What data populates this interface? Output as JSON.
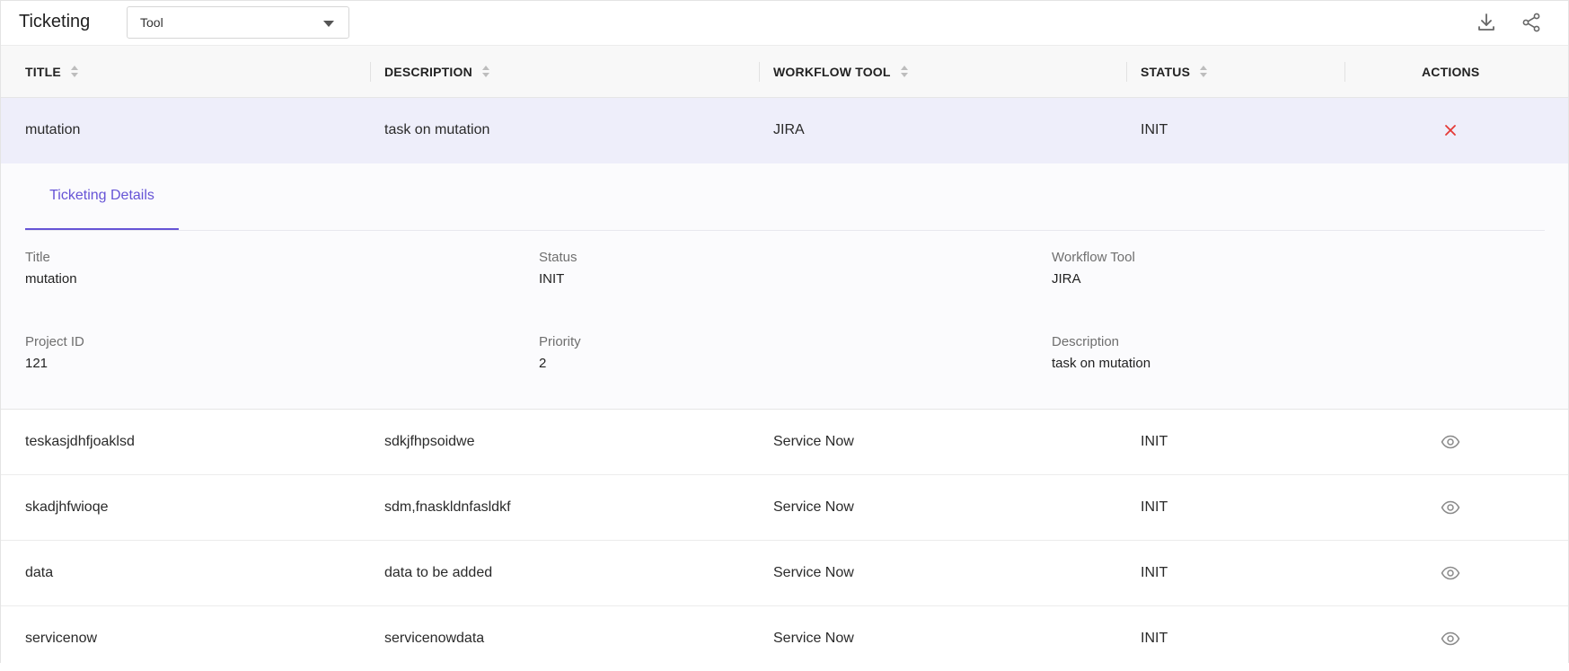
{
  "header": {
    "title": "Ticketing",
    "tool_select": {
      "value": "Tool"
    },
    "icons": {
      "download": "download-icon",
      "share": "share-icon"
    }
  },
  "table": {
    "columns": [
      {
        "label": "TITLE",
        "sortable": true
      },
      {
        "label": "DESCRIPTION",
        "sortable": true
      },
      {
        "label": "WORKFLOW TOOL",
        "sortable": true
      },
      {
        "label": "STATUS",
        "sortable": true
      },
      {
        "label": "ACTIONS",
        "sortable": false
      }
    ],
    "selected_row": {
      "title": "mutation",
      "description": "task on mutation",
      "tool": "JIRA",
      "status": "INIT",
      "action_icon": "close-icon"
    },
    "rows": [
      {
        "title": "teskasjdhfjoaklsd",
        "description": "sdkjfhpsoidwe",
        "tool": "Service Now",
        "status": "INIT",
        "action_icon": "eye-icon"
      },
      {
        "title": "skadjhfwioqe",
        "description": "sdm,fnaskldnfasldkf",
        "tool": "Service Now",
        "status": "INIT",
        "action_icon": "eye-icon"
      },
      {
        "title": "data",
        "description": "data to be added",
        "tool": "Service Now",
        "status": "INIT",
        "action_icon": "eye-icon"
      },
      {
        "title": "servicenow",
        "description": "servicenowdata",
        "tool": "Service Now",
        "status": "INIT",
        "action_icon": "eye-icon"
      }
    ]
  },
  "details": {
    "tab_label": "Ticketing Details",
    "fields": [
      {
        "label": "Title",
        "value": "mutation"
      },
      {
        "label": "Status",
        "value": "INIT"
      },
      {
        "label": "Workflow Tool",
        "value": "JIRA"
      },
      {
        "label": "Project ID",
        "value": "121"
      },
      {
        "label": "Priority",
        "value": "2"
      },
      {
        "label": "Description",
        "value": "task on mutation"
      }
    ]
  },
  "colors": {
    "accent": "#6654d6",
    "selected_row_bg": "#eeeefa",
    "close_icon": "#e53935"
  }
}
